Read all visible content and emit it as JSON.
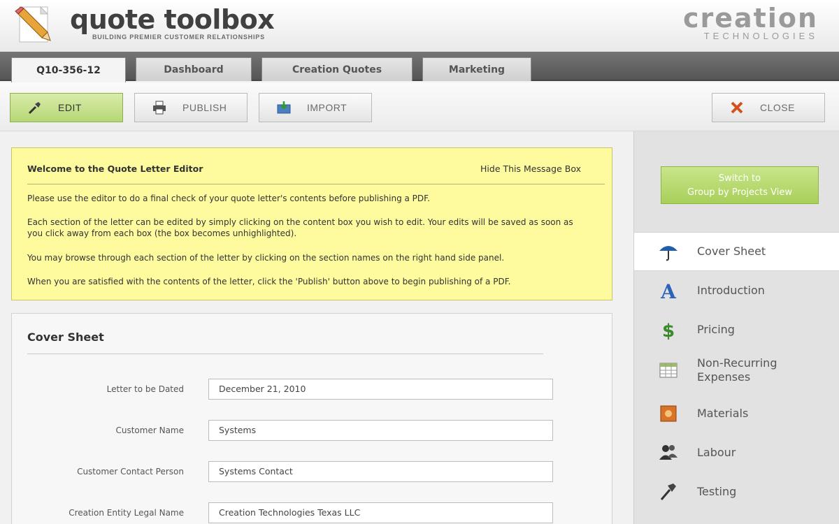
{
  "header": {
    "app_title": "quote toolbox",
    "tagline": "BUILDING PREMIER CUSTOMER RELATIONSHIPS",
    "brand_main": "creation",
    "brand_sub": "TECHNOLOGIES"
  },
  "tabs": [
    {
      "label": "Q10-356-12",
      "active": true
    },
    {
      "label": "Dashboard",
      "active": false
    },
    {
      "label": "Creation Quotes",
      "active": false
    },
    {
      "label": "Marketing",
      "active": false
    }
  ],
  "toolbar": {
    "edit_label": "EDIT",
    "publish_label": "PUBLISH",
    "import_label": "IMPORT",
    "close_label": "CLOSE"
  },
  "message_box": {
    "title": "Welcome to the Quote Letter Editor",
    "hide_label": "Hide This Message Box",
    "paragraphs": [
      "Please use the editor to do a final check of your quote letter's contents before publishing a PDF.",
      "Each section of the letter can be edited by simply clicking on the content box you wish to edit. Your edits will be saved as soon as you click away from each box (the box becomes unhighlighted).",
      "You may browse through each section of the letter by clicking on the section names on the right hand side panel.",
      "When you are satisfied with the contents of the letter, click the 'Publish' button above to begin publishing of a PDF."
    ]
  },
  "cover_sheet": {
    "title": "Cover Sheet",
    "fields": [
      {
        "label": "Letter to be Dated",
        "value": "December 21, 2010"
      },
      {
        "label": "Customer Name",
        "value": "Systems"
      },
      {
        "label": "Customer Contact Person",
        "value": "Systems Contact"
      },
      {
        "label": "Creation Entity Legal Name",
        "value": "Creation Technologies Texas LLC"
      }
    ]
  },
  "sidebar": {
    "switch_line1": "Switch to",
    "switch_line2": "Group by Projects View",
    "items": [
      {
        "label": "Cover Sheet",
        "icon": "umbrella-icon",
        "active": true
      },
      {
        "label": "Introduction",
        "icon": "letter-a-icon",
        "active": false
      },
      {
        "label": "Pricing",
        "icon": "dollar-icon",
        "active": false
      },
      {
        "label_line1": "Non-Recurring",
        "label_line2": "Expenses",
        "icon": "spreadsheet-icon",
        "active": false
      },
      {
        "label": "Materials",
        "icon": "materials-icon",
        "active": false
      },
      {
        "label": "Labour",
        "icon": "people-icon",
        "active": false
      },
      {
        "label": "Testing",
        "icon": "hammer-icon",
        "active": false
      }
    ]
  },
  "colors": {
    "accent_green": "#b6d774",
    "message_yellow": "#fdfb9d",
    "tab_bar": "#5f5f5f"
  }
}
